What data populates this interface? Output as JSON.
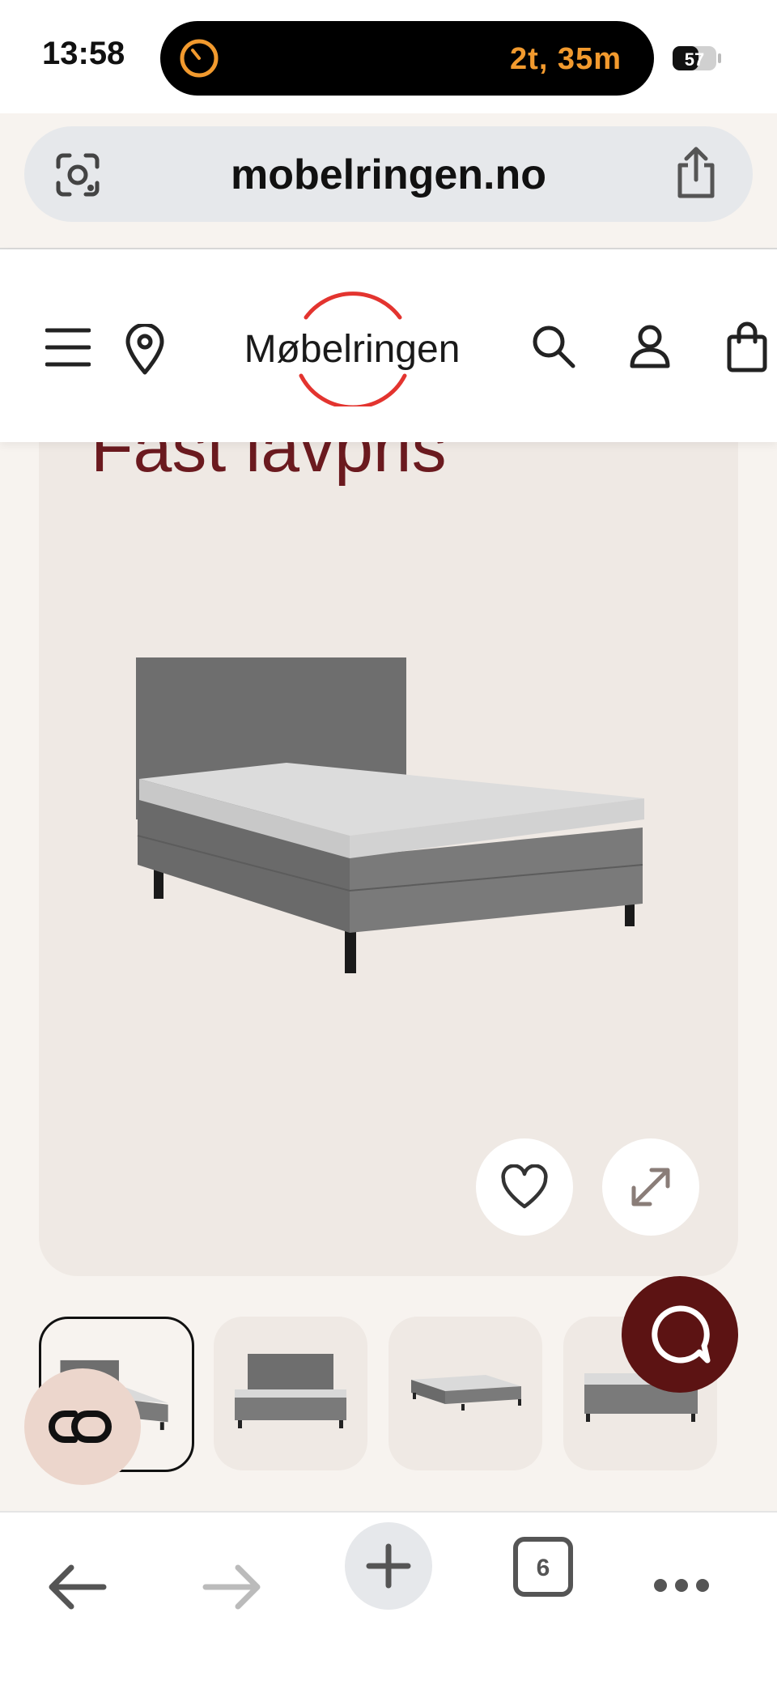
{
  "status_bar": {
    "time": "13:58",
    "activity_timer": "2t, 35m",
    "battery_level": "57",
    "accent_color": "#f29a2e"
  },
  "browser": {
    "url": "mobelringen.no",
    "tab_count": "6",
    "icons": [
      "lens-icon",
      "share-icon",
      "back-icon",
      "forward-icon",
      "plus-icon",
      "tabs-icon",
      "more-icon"
    ]
  },
  "site": {
    "logo_text": "Møbelringen",
    "brand_color": "#e3342f",
    "header_icons": [
      "menu-icon",
      "location-pin-icon",
      "search-icon",
      "account-icon",
      "cart-icon"
    ]
  },
  "product": {
    "promo_label": "Fast lavpris",
    "promo_color": "#6b1a1f",
    "selected_thumbnail_index": 0,
    "thumbnail_count": 4
  },
  "floating": {
    "chat_color": "#5c1313",
    "co_color": "#ecd6cc"
  }
}
